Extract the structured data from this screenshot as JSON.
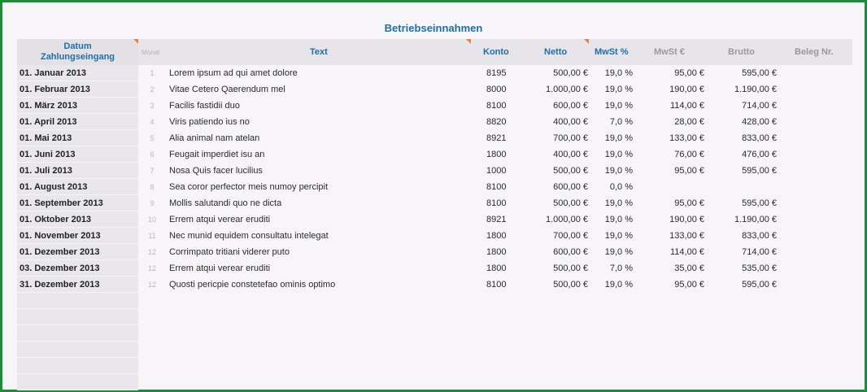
{
  "title": "Betriebseinnahmen",
  "columns": {
    "date_line1": "Datum",
    "date_line2": "Zahlungseingang",
    "monat": "Monat",
    "text": "Text",
    "konto": "Konto",
    "netto": "Netto",
    "mwst_pct": "MwSt %",
    "mwst_eur": "MwSt €",
    "brutto": "Brutto",
    "beleg": "Beleg Nr."
  },
  "rows": [
    {
      "date": "01. Januar 2013",
      "monat": "1",
      "text": "Lorem ipsum ad qui amet dolore",
      "konto": "8195",
      "netto": "500,00 €",
      "pct": "19,0 %",
      "mwst": "95,00 €",
      "brutto": "595,00 €"
    },
    {
      "date": "01. Februar 2013",
      "monat": "2",
      "text": "Vitae Cetero Qaerendum mel",
      "konto": "8000",
      "netto": "1.000,00 €",
      "pct": "19,0 %",
      "mwst": "190,00 €",
      "brutto": "1.190,00 €"
    },
    {
      "date": "01. März 2013",
      "monat": "3",
      "text": "Facilis fastidii duo",
      "konto": "8100",
      "netto": "600,00 €",
      "pct": "19,0 %",
      "mwst": "114,00 €",
      "brutto": "714,00 €"
    },
    {
      "date": "01. April 2013",
      "monat": "4",
      "text": "Viris patiendo ius no",
      "konto": "8820",
      "netto": "400,00 €",
      "pct": "7,0 %",
      "mwst": "28,00 €",
      "brutto": "428,00 €"
    },
    {
      "date": "01. Mai 2013",
      "monat": "5",
      "text": "Alia animal nam atelan",
      "konto": "8921",
      "netto": "700,00 €",
      "pct": "19,0 %",
      "mwst": "133,00 €",
      "brutto": "833,00 €"
    },
    {
      "date": "01. Juni 2013",
      "monat": "6",
      "text": "Feugait imperdiet isu an",
      "konto": "1800",
      "netto": "400,00 €",
      "pct": "19,0 %",
      "mwst": "76,00 €",
      "brutto": "476,00 €"
    },
    {
      "date": "01. Juli 2013",
      "monat": "7",
      "text": "Nosa Quis facer lucilius",
      "konto": "1000",
      "netto": "500,00 €",
      "pct": "19,0 %",
      "mwst": "95,00 €",
      "brutto": "595,00 €"
    },
    {
      "date": "01. August 2013",
      "monat": "8",
      "text": "Sea coror perfector meis numoy percipit",
      "konto": "8100",
      "netto": "600,00 €",
      "pct": "0,0 %",
      "mwst": "",
      "brutto": ""
    },
    {
      "date": "01. September 2013",
      "monat": "9",
      "text": "Mollis salutandi quo ne dicta",
      "konto": "8100",
      "netto": "500,00 €",
      "pct": "19,0 %",
      "mwst": "95,00 €",
      "brutto": "595,00 €"
    },
    {
      "date": "01. Oktober 2013",
      "monat": "10",
      "text": "Errem atqui verear eruditi",
      "konto": "8921",
      "netto": "1.000,00 €",
      "pct": "19,0 %",
      "mwst": "190,00 €",
      "brutto": "1.190,00 €"
    },
    {
      "date": "01. November 2013",
      "monat": "11",
      "text": "Nec munid equidem consultatu intelegat",
      "konto": "1800",
      "netto": "700,00 €",
      "pct": "19,0 %",
      "mwst": "133,00 €",
      "brutto": "833,00 €"
    },
    {
      "date": "01. Dezember 2013",
      "monat": "12",
      "text": "Corrimpato tritiani viderer puto",
      "konto": "1800",
      "netto": "600,00 €",
      "pct": "19,0 %",
      "mwst": "114,00 €",
      "brutto": "714,00 €"
    },
    {
      "date": "03. Dezember 2013",
      "monat": "12",
      "text": "Errem atqui verear eruditi",
      "konto": "1800",
      "netto": "500,00 €",
      "pct": "7,0 %",
      "mwst": "35,00 €",
      "brutto": "535,00 €"
    },
    {
      "date": "31. Dezember 2013",
      "monat": "12",
      "text": "Quosti pericpie constetefao ominis optimo",
      "konto": "8100",
      "netto": "500,00 €",
      "pct": "19,0 %",
      "mwst": "95,00 €",
      "brutto": "595,00 €"
    }
  ],
  "colors": {
    "frame": "#1e8a3c",
    "header_blue": "#1d6fa8",
    "header_gray": "#9a989c",
    "corner_marker": "#e8804a",
    "background": "#f7f5f8"
  }
}
